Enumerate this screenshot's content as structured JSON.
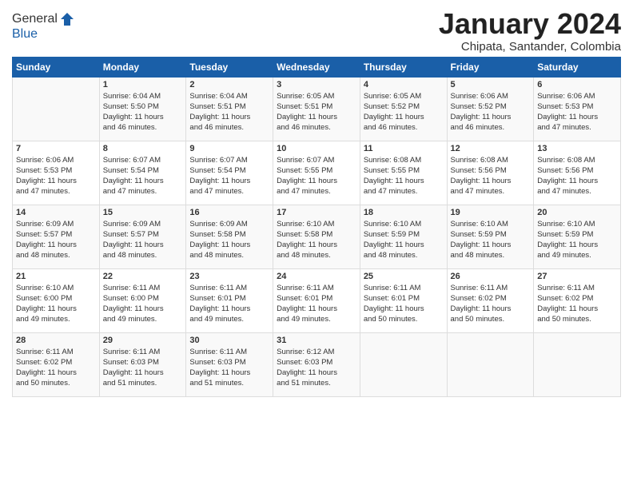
{
  "header": {
    "logo_line1": "General",
    "logo_line2": "Blue",
    "month_title": "January 2024",
    "location": "Chipata, Santander, Colombia"
  },
  "days_of_week": [
    "Sunday",
    "Monday",
    "Tuesday",
    "Wednesday",
    "Thursday",
    "Friday",
    "Saturday"
  ],
  "weeks": [
    {
      "cells": [
        {
          "day": "",
          "info": ""
        },
        {
          "day": "1",
          "info": "Sunrise: 6:04 AM\nSunset: 5:50 PM\nDaylight: 11 hours\nand 46 minutes."
        },
        {
          "day": "2",
          "info": "Sunrise: 6:04 AM\nSunset: 5:51 PM\nDaylight: 11 hours\nand 46 minutes."
        },
        {
          "day": "3",
          "info": "Sunrise: 6:05 AM\nSunset: 5:51 PM\nDaylight: 11 hours\nand 46 minutes."
        },
        {
          "day": "4",
          "info": "Sunrise: 6:05 AM\nSunset: 5:52 PM\nDaylight: 11 hours\nand 46 minutes."
        },
        {
          "day": "5",
          "info": "Sunrise: 6:06 AM\nSunset: 5:52 PM\nDaylight: 11 hours\nand 46 minutes."
        },
        {
          "day": "6",
          "info": "Sunrise: 6:06 AM\nSunset: 5:53 PM\nDaylight: 11 hours\nand 47 minutes."
        }
      ]
    },
    {
      "cells": [
        {
          "day": "7",
          "info": "Sunrise: 6:06 AM\nSunset: 5:53 PM\nDaylight: 11 hours\nand 47 minutes."
        },
        {
          "day": "8",
          "info": "Sunrise: 6:07 AM\nSunset: 5:54 PM\nDaylight: 11 hours\nand 47 minutes."
        },
        {
          "day": "9",
          "info": "Sunrise: 6:07 AM\nSunset: 5:54 PM\nDaylight: 11 hours\nand 47 minutes."
        },
        {
          "day": "10",
          "info": "Sunrise: 6:07 AM\nSunset: 5:55 PM\nDaylight: 11 hours\nand 47 minutes."
        },
        {
          "day": "11",
          "info": "Sunrise: 6:08 AM\nSunset: 5:55 PM\nDaylight: 11 hours\nand 47 minutes."
        },
        {
          "day": "12",
          "info": "Sunrise: 6:08 AM\nSunset: 5:56 PM\nDaylight: 11 hours\nand 47 minutes."
        },
        {
          "day": "13",
          "info": "Sunrise: 6:08 AM\nSunset: 5:56 PM\nDaylight: 11 hours\nand 47 minutes."
        }
      ]
    },
    {
      "cells": [
        {
          "day": "14",
          "info": "Sunrise: 6:09 AM\nSunset: 5:57 PM\nDaylight: 11 hours\nand 48 minutes."
        },
        {
          "day": "15",
          "info": "Sunrise: 6:09 AM\nSunset: 5:57 PM\nDaylight: 11 hours\nand 48 minutes."
        },
        {
          "day": "16",
          "info": "Sunrise: 6:09 AM\nSunset: 5:58 PM\nDaylight: 11 hours\nand 48 minutes."
        },
        {
          "day": "17",
          "info": "Sunrise: 6:10 AM\nSunset: 5:58 PM\nDaylight: 11 hours\nand 48 minutes."
        },
        {
          "day": "18",
          "info": "Sunrise: 6:10 AM\nSunset: 5:59 PM\nDaylight: 11 hours\nand 48 minutes."
        },
        {
          "day": "19",
          "info": "Sunrise: 6:10 AM\nSunset: 5:59 PM\nDaylight: 11 hours\nand 48 minutes."
        },
        {
          "day": "20",
          "info": "Sunrise: 6:10 AM\nSunset: 5:59 PM\nDaylight: 11 hours\nand 49 minutes."
        }
      ]
    },
    {
      "cells": [
        {
          "day": "21",
          "info": "Sunrise: 6:10 AM\nSunset: 6:00 PM\nDaylight: 11 hours\nand 49 minutes."
        },
        {
          "day": "22",
          "info": "Sunrise: 6:11 AM\nSunset: 6:00 PM\nDaylight: 11 hours\nand 49 minutes."
        },
        {
          "day": "23",
          "info": "Sunrise: 6:11 AM\nSunset: 6:01 PM\nDaylight: 11 hours\nand 49 minutes."
        },
        {
          "day": "24",
          "info": "Sunrise: 6:11 AM\nSunset: 6:01 PM\nDaylight: 11 hours\nand 49 minutes."
        },
        {
          "day": "25",
          "info": "Sunrise: 6:11 AM\nSunset: 6:01 PM\nDaylight: 11 hours\nand 50 minutes."
        },
        {
          "day": "26",
          "info": "Sunrise: 6:11 AM\nSunset: 6:02 PM\nDaylight: 11 hours\nand 50 minutes."
        },
        {
          "day": "27",
          "info": "Sunrise: 6:11 AM\nSunset: 6:02 PM\nDaylight: 11 hours\nand 50 minutes."
        }
      ]
    },
    {
      "cells": [
        {
          "day": "28",
          "info": "Sunrise: 6:11 AM\nSunset: 6:02 PM\nDaylight: 11 hours\nand 50 minutes."
        },
        {
          "day": "29",
          "info": "Sunrise: 6:11 AM\nSunset: 6:03 PM\nDaylight: 11 hours\nand 51 minutes."
        },
        {
          "day": "30",
          "info": "Sunrise: 6:11 AM\nSunset: 6:03 PM\nDaylight: 11 hours\nand 51 minutes."
        },
        {
          "day": "31",
          "info": "Sunrise: 6:12 AM\nSunset: 6:03 PM\nDaylight: 11 hours\nand 51 minutes."
        },
        {
          "day": "",
          "info": ""
        },
        {
          "day": "",
          "info": ""
        },
        {
          "day": "",
          "info": ""
        }
      ]
    }
  ]
}
